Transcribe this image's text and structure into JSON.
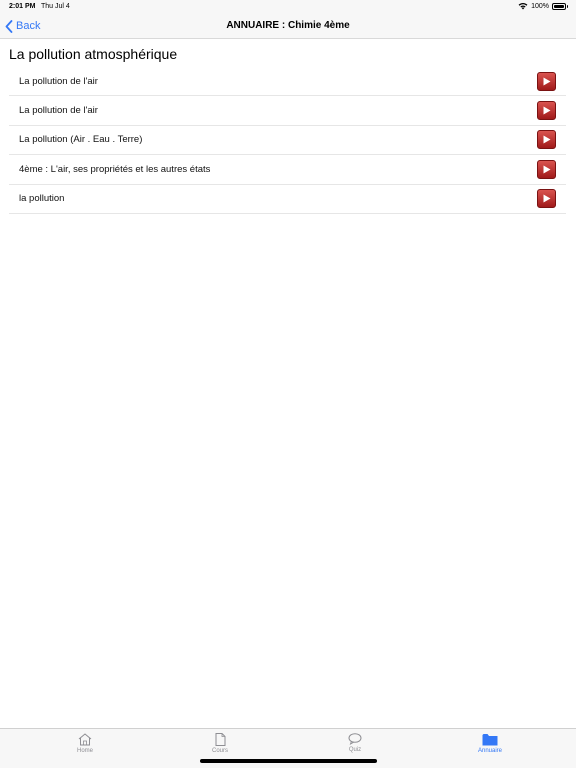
{
  "status_bar": {
    "time": "2:01 PM",
    "date": "Thu Jul 4",
    "battery": "100%"
  },
  "nav": {
    "back_label": "Back",
    "title": "ANNUAIRE : Chimie 4ème"
  },
  "section": {
    "title": "La pollution atmosphérique"
  },
  "items": [
    {
      "label": "La pollution de l'air"
    },
    {
      "label": "La pollution de l'air"
    },
    {
      "label": "La pollution (Air . Eau . Terre)"
    },
    {
      "label": "4ème : L'air, ses propriétés et les autres états"
    },
    {
      "label": "la pollution"
    }
  ],
  "tabs": [
    {
      "label": "Home",
      "icon": "house-icon"
    },
    {
      "label": "Cours",
      "icon": "document-icon"
    },
    {
      "label": "Quiz",
      "icon": "speech-bubble-icon"
    },
    {
      "label": "Annuaire",
      "icon": "folder-icon",
      "active": true
    }
  ],
  "colors": {
    "accent": "#3478f6",
    "play": "#b52a25",
    "inactive": "#8e8e93"
  }
}
